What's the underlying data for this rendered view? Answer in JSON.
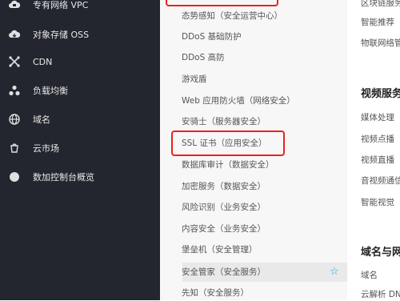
{
  "sidebar": {
    "items": [
      {
        "label": "专有网络 VPC",
        "icon": "vpc-cloud-icon"
      },
      {
        "label": "对象存储 OSS",
        "icon": "oss-cloud-icon"
      },
      {
        "label": "CDN",
        "icon": "cdn-icon"
      },
      {
        "label": "负载均衡",
        "icon": "load-balance-icon"
      },
      {
        "label": "域名",
        "icon": "globe-icon"
      },
      {
        "label": "云市场",
        "icon": "market-icon"
      },
      {
        "label": "数加控制台概览",
        "icon": "dot-icon"
      }
    ]
  },
  "security_menu": {
    "items": [
      "态势感知（安全运营中心）",
      "DDoS 基础防护",
      "DDoS 高防",
      "游戏盾",
      "Web 应用防火墙（网络安全）",
      "安骑士（服务器安全）",
      "SSL 证书（应用安全）",
      "数据库审计（数据安全）",
      "加密服务（数据安全）",
      "风险识别（业务安全）",
      "内容安全（业务安全）",
      "堡垒机（安全管理）",
      "安全管家（安全服务）",
      "先知（安全服务）"
    ],
    "star": "☆"
  },
  "right_column": {
    "top_items": [
      "区块链服务",
      "智能推荐",
      "物联网络管"
    ],
    "video_heading": "视频服务",
    "video_items": [
      "媒体处理",
      "视频点播",
      "视频直播",
      "音视频通信",
      "智能视觉"
    ],
    "domain_heading": "域名与网",
    "domain_items": [
      "域名",
      "云解析 DN"
    ]
  }
}
